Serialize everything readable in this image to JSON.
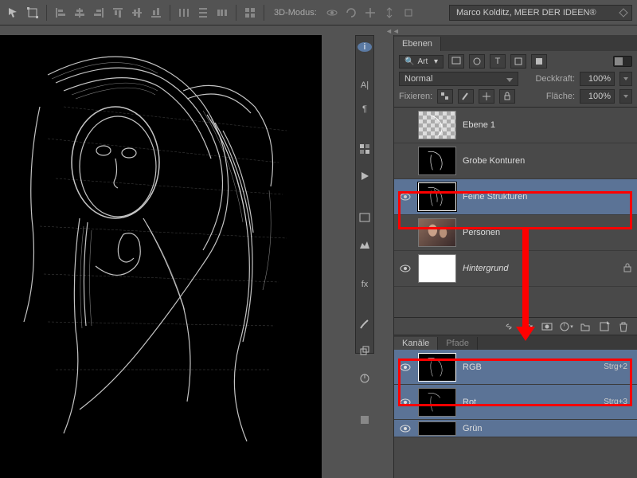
{
  "toolbar": {
    "mode_label": "3D-Modus:",
    "workspace": "Marco Kolditz, MEER DER IDEEN®"
  },
  "layers_panel": {
    "title": "Ebenen",
    "search_kind": "Art",
    "blend_mode": "Normal",
    "opacity_label": "Deckkraft:",
    "opacity_value": "100%",
    "lock_label": "Fixieren:",
    "fill_label": "Fläche:",
    "fill_value": "100%",
    "layers": [
      {
        "name": "Ebene 1",
        "visible": false
      },
      {
        "name": "Grobe Konturen",
        "visible": false
      },
      {
        "name": "Feine Strukturen",
        "visible": true,
        "selected": true
      },
      {
        "name": "Personen",
        "visible": false
      },
      {
        "name": "Hintergrund",
        "visible": true,
        "locked": true,
        "italic": true
      }
    ]
  },
  "channels_panel": {
    "tab1": "Kanäle",
    "tab2": "Pfade",
    "channels": [
      {
        "name": "RGB",
        "shortcut": "Strg+2"
      },
      {
        "name": "Rot",
        "shortcut": "Strg+3"
      },
      {
        "name": "Grün",
        "shortcut": ""
      }
    ]
  }
}
